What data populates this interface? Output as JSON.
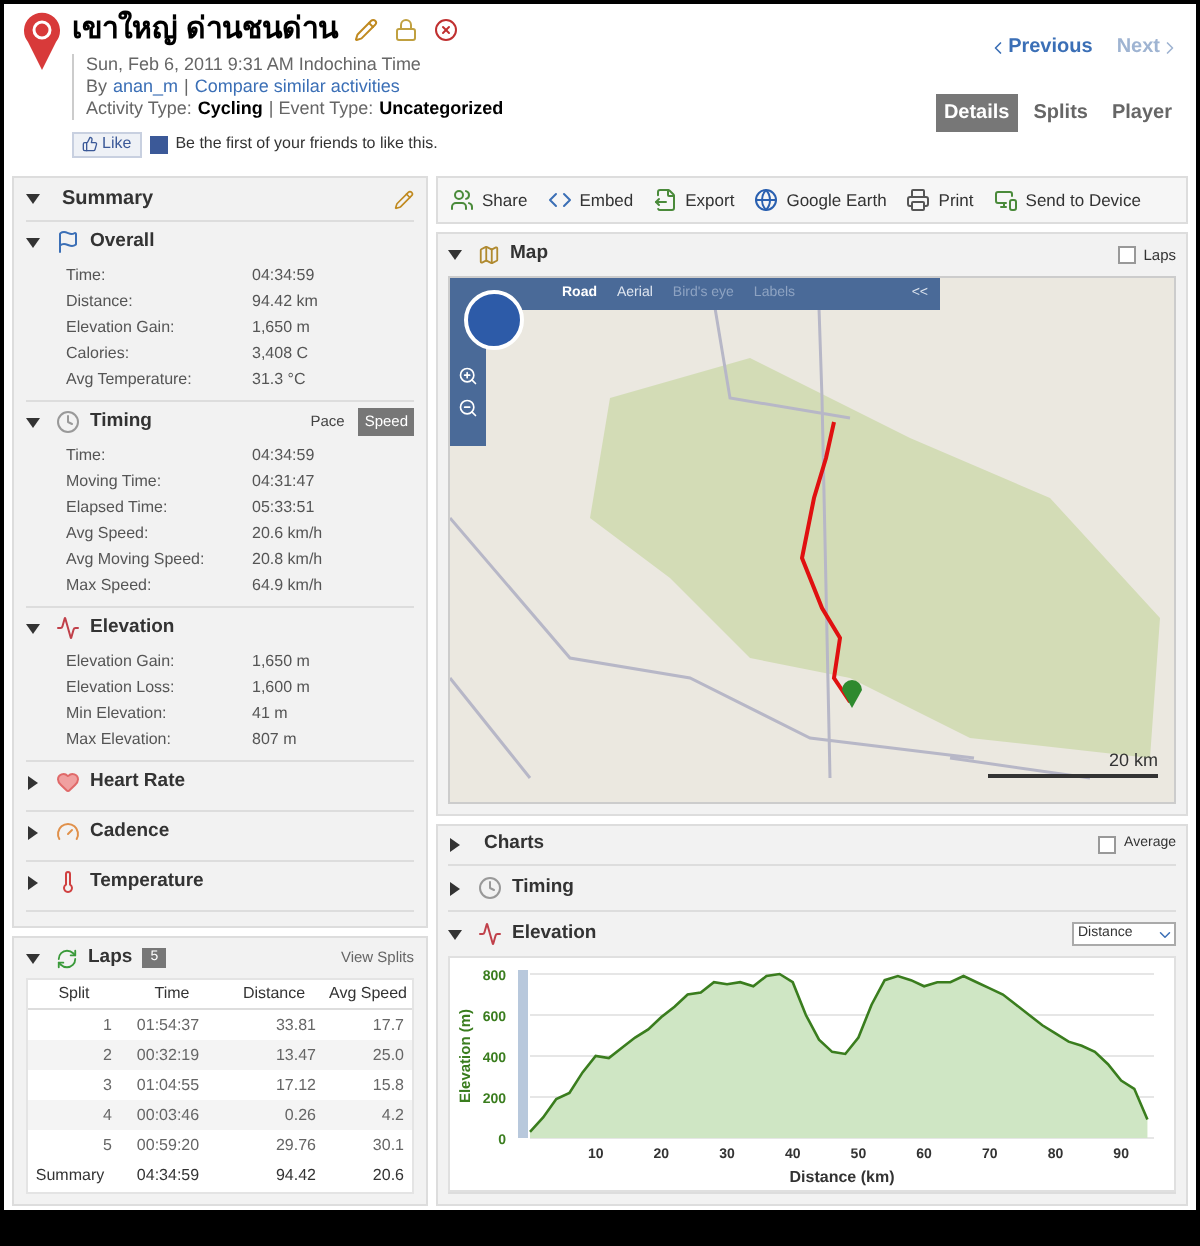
{
  "activity": {
    "title": "เขาใหญ่ ด่านชนด่าน",
    "date": "Sun, Feb 6, 2011 9:31 AM Indochina Time",
    "by_prefix": "By",
    "author": "anan_m",
    "separator": "|",
    "compare_link": "Compare similar activities",
    "activity_type_label": "Activity Type:",
    "activity_type": "Cycling",
    "event_type_label": "| Event Type:",
    "event_type": "Uncategorized"
  },
  "like": {
    "button": "Like",
    "text": "Be the first of your friends to like this."
  },
  "nav": [
    {
      "kind": "previous",
      "label": "Previous",
      "disabled": false
    },
    {
      "kind": "next",
      "label": "Next",
      "disabled": true
    }
  ],
  "view_tabs": [
    {
      "label": "Details",
      "selected": true
    },
    {
      "label": "Splits",
      "selected": false
    },
    {
      "label": "Player",
      "selected": false
    }
  ],
  "summary": {
    "title": "Summary",
    "sections": [
      {
        "kind": "overall",
        "title": "Overall",
        "expanded": true,
        "rows": [
          {
            "label": "Time:",
            "value": "04:34:59"
          },
          {
            "label": "Distance:",
            "value": "94.42 km"
          },
          {
            "label": "Elevation Gain:",
            "value": "1,650 m"
          },
          {
            "label": "Calories:",
            "value": "3,408 C"
          },
          {
            "label": "Avg Temperature:",
            "value": "31.3 °C"
          }
        ]
      },
      {
        "kind": "timing",
        "title": "Timing",
        "expanded": true,
        "toggle": [
          {
            "label": "Pace",
            "selected": false
          },
          {
            "label": "Speed",
            "selected": true
          }
        ],
        "rows": [
          {
            "label": "Time:",
            "value": "04:34:59"
          },
          {
            "label": "Moving Time:",
            "value": "04:31:47"
          },
          {
            "label": "Elapsed Time:",
            "value": "05:33:51"
          },
          {
            "label": "Avg Speed:",
            "value": "20.6 km/h"
          },
          {
            "label": "Avg Moving Speed:",
            "value": "20.8 km/h"
          },
          {
            "label": "Max Speed:",
            "value": "64.9 km/h"
          }
        ]
      },
      {
        "kind": "elevation",
        "title": "Elevation",
        "expanded": true,
        "rows": [
          {
            "label": "Elevation Gain:",
            "value": "1,650 m"
          },
          {
            "label": "Elevation Loss:",
            "value": "1,600 m"
          },
          {
            "label": "Min Elevation:",
            "value": "41 m"
          },
          {
            "label": "Max Elevation:",
            "value": "807 m"
          }
        ]
      },
      {
        "kind": "heart_rate",
        "title": "Heart Rate",
        "expanded": false
      },
      {
        "kind": "cadence",
        "title": "Cadence",
        "expanded": false
      },
      {
        "kind": "temperature",
        "title": "Temperature",
        "expanded": false
      }
    ]
  },
  "laps": {
    "title": "Laps",
    "count": "5",
    "view_link": "View Splits",
    "columns": [
      "Split",
      "Time",
      "Distance",
      "Avg Speed"
    ],
    "rows": [
      [
        "1",
        "01:54:37",
        "33.81",
        "17.7"
      ],
      [
        "2",
        "00:32:19",
        "13.47",
        "25.0"
      ],
      [
        "3",
        "01:04:55",
        "17.12",
        "15.8"
      ],
      [
        "4",
        "00:03:46",
        "0.26",
        "4.2"
      ],
      [
        "5",
        "00:59:20",
        "29.76",
        "30.1"
      ]
    ],
    "summary_row": [
      "Summary",
      "04:34:59",
      "94.42",
      "20.6"
    ]
  },
  "toolbar": [
    {
      "kind": "share",
      "label": "Share"
    },
    {
      "kind": "embed",
      "label": "Embed"
    },
    {
      "kind": "export",
      "label": "Export"
    },
    {
      "kind": "earth",
      "label": "Google Earth"
    },
    {
      "kind": "print",
      "label": "Print"
    },
    {
      "kind": "device",
      "label": "Send to Device"
    }
  ],
  "map": {
    "title": "Map",
    "expanded": true,
    "laps_checkbox": {
      "label": "Laps",
      "checked": false
    },
    "map_types": [
      {
        "label": "Road",
        "selected": true,
        "disabled": false
      },
      {
        "label": "Aerial",
        "selected": false,
        "disabled": false
      },
      {
        "label": "Bird's eye",
        "selected": false,
        "disabled": true
      },
      {
        "label": "Labels",
        "selected": false,
        "disabled": true
      }
    ],
    "collapse": "<<",
    "scale": "20 km"
  },
  "charts": {
    "title": "Charts",
    "expanded": false,
    "average": {
      "label": "Average",
      "checked": false
    },
    "sections": [
      {
        "kind": "timing",
        "title": "Timing",
        "expanded": false
      },
      {
        "kind": "elevation",
        "title": "Elevation",
        "expanded": true,
        "axis_select": "Distance",
        "chart_data": {
          "type": "area",
          "xlabel": "Distance (km)",
          "ylabel": "Elevation (m)",
          "xlim": [
            0,
            95
          ],
          "ylim": [
            0,
            800
          ],
          "grid": true,
          "xticks": [
            10,
            20,
            30,
            40,
            50,
            60,
            70,
            80,
            90
          ],
          "yticks": [
            0,
            200,
            400,
            600,
            800
          ],
          "x": [
            0,
            2,
            4,
            6,
            8,
            10,
            12,
            14,
            16,
            18,
            20,
            22,
            24,
            26,
            28,
            30,
            32,
            34,
            36,
            38,
            40,
            42,
            44,
            46,
            48,
            50,
            52,
            54,
            56,
            58,
            60,
            62,
            64,
            66,
            68,
            70,
            72,
            74,
            76,
            78,
            80,
            82,
            84,
            86,
            88,
            90,
            92,
            94
          ],
          "series": [
            {
              "color": "#3a7d1e",
              "values": [
                30,
                100,
                190,
                220,
                320,
                400,
                390,
                440,
                490,
                530,
                590,
                640,
                700,
                710,
                760,
                750,
                760,
                740,
                790,
                800,
                760,
                600,
                480,
                420,
                410,
                490,
                650,
                770,
                790,
                770,
                740,
                760,
                760,
                790,
                760,
                730,
                700,
                650,
                600,
                550,
                510,
                470,
                450,
                420,
                360,
                280,
                240,
                90
              ]
            }
          ]
        }
      }
    ]
  }
}
